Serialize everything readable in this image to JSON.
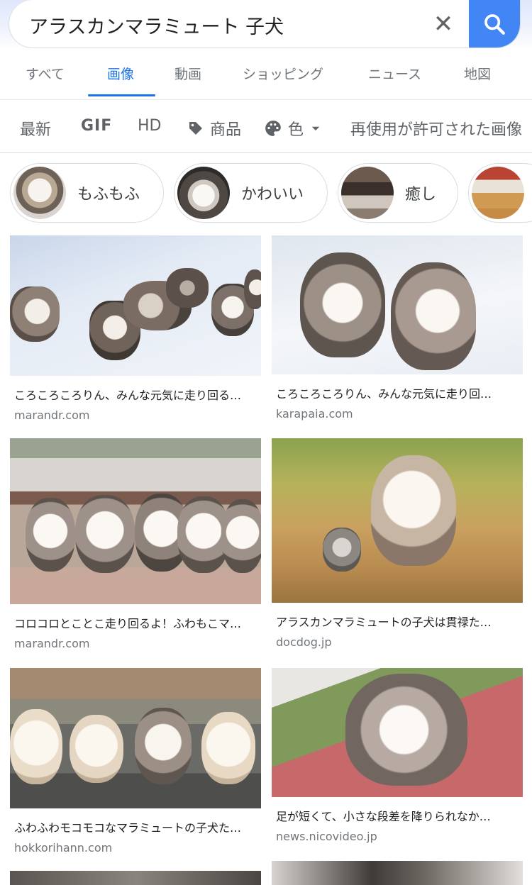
{
  "search": {
    "query": "アラスカンマラミュート 子犬",
    "clear_icon": "close-icon",
    "submit_icon": "search-icon",
    "accent": "#4285f4"
  },
  "tabs": [
    {
      "label": "すべて",
      "active": false
    },
    {
      "label": "画像",
      "active": true
    },
    {
      "label": "動画",
      "active": false
    },
    {
      "label": "ショッピング",
      "active": false
    },
    {
      "label": "ニュース",
      "active": false
    },
    {
      "label": "地図",
      "active": false
    }
  ],
  "filters": [
    {
      "label": "最新"
    },
    {
      "label": "GIF"
    },
    {
      "label": "HD"
    },
    {
      "label": "商品",
      "icon": "tag-icon"
    },
    {
      "label": "色",
      "icon": "palette-icon"
    },
    {
      "label": "再使用が許可された画像"
    }
  ],
  "chips": [
    {
      "label": "もふもふ"
    },
    {
      "label": "かわいい"
    },
    {
      "label": "癒し"
    },
    {
      "label": ""
    }
  ],
  "results": [
    {
      "title": "ころころころりん、みんな元気に走り回る…",
      "source": "marandr.com"
    },
    {
      "title": "ころころころりん、みんな元気に走り回…",
      "source": "karapaia.com"
    },
    {
      "title": "コロコロとことこ走り回るよ！ふわもこマ…",
      "source": "marandr.com"
    },
    {
      "title": "アラスカンマラミュートの子犬は貫禄た…",
      "source": "docdog.jp"
    },
    {
      "title": "ふわふわモコモコなマラミュートの子犬た…",
      "source": "hokkorihann.com"
    },
    {
      "title": "足が短くて、小さな段差を降りられなか…",
      "source": "news.nicovideo.jp"
    }
  ]
}
